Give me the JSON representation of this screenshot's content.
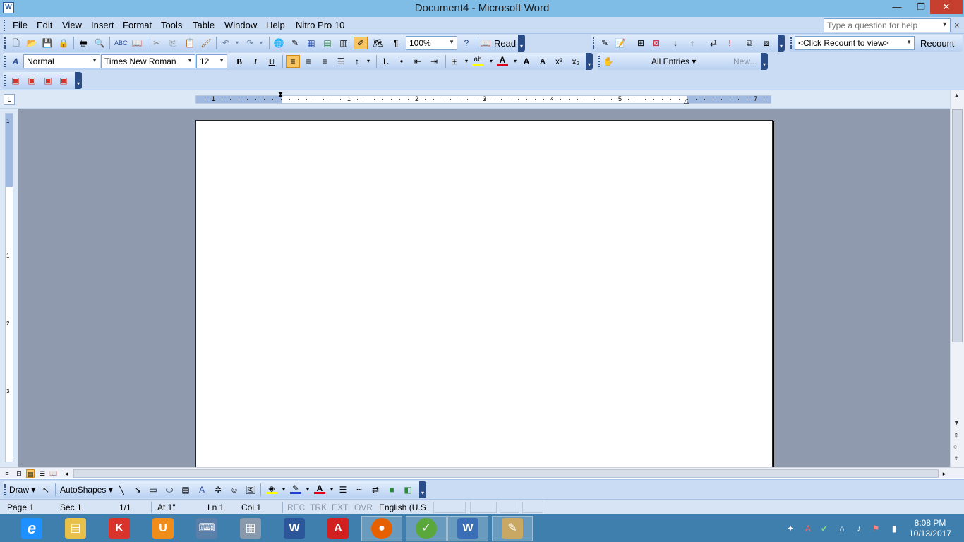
{
  "window": {
    "title": "Document4 - Microsoft Word",
    "min_glyph": "—",
    "max_glyph": "❐",
    "close_glyph": "✕"
  },
  "menu": {
    "items": [
      "File",
      "Edit",
      "View",
      "Insert",
      "Format",
      "Tools",
      "Table",
      "Window",
      "Help",
      "Nitro Pro 10"
    ],
    "help_placeholder": "Type a question for help",
    "doc_close_glyph": "×"
  },
  "standard_toolbar": {
    "zoom": "100%",
    "read_label": "Read",
    "icons": [
      "new-icon",
      "open-icon",
      "save-icon",
      "permission-icon",
      "print-icon",
      "print-preview-icon",
      "spelling-icon",
      "research-icon",
      "cut-icon",
      "copy-icon",
      "paste-icon",
      "format-painter-icon",
      "undo-icon",
      "redo-icon",
      "hyperlink-icon",
      "tables-borders-icon",
      "insert-table-icon",
      "insert-excel-icon",
      "columns-icon",
      "drawing-icon",
      "document-map-icon",
      "show-hide-icon",
      "help-icon"
    ]
  },
  "formatting_toolbar": {
    "style": "Normal",
    "font": "Times New Roman",
    "size": "12",
    "bold": "B",
    "italic": "I",
    "underline": "U",
    "highlight_color": "#ffff00",
    "font_color": "#e0001b"
  },
  "word_count_toolbar": {
    "recount_value": "<Click Recount to view>",
    "recount_label": "Recount"
  },
  "autotext_toolbar": {
    "all_entries": "All Entries ▾",
    "new_label": "New..."
  },
  "ruler": {
    "numbers": [
      "1",
      "1",
      "2",
      "3",
      "4",
      "5",
      "7"
    ],
    "tab_stop": "L"
  },
  "vertical_ruler": {
    "numbers": [
      "1",
      "1",
      "2",
      "3"
    ]
  },
  "draw_toolbar": {
    "draw_label": "Draw ▾",
    "autoshapes_label": "AutoShapes ▾"
  },
  "status": {
    "page": "Page 1",
    "sec": "Sec 1",
    "pages": "1/1",
    "at": "At 1\"",
    "ln": "Ln 1",
    "col": "Col 1",
    "rec": "REC",
    "trk": "TRK",
    "ext": "EXT",
    "ovr": "OVR",
    "language": "English (U.S"
  },
  "taskbar": {
    "apps": [
      {
        "name": "internet-explorer-icon",
        "glyph": "e",
        "color": "#1e90ff"
      },
      {
        "name": "file-explorer-icon",
        "glyph": "▤",
        "color": "#e8c14a"
      },
      {
        "name": "kingsoft-icon",
        "glyph": "K",
        "color": "#d9332b"
      },
      {
        "name": "uc-browser-icon",
        "glyph": "U",
        "color": "#f08c1a"
      },
      {
        "name": "keyboard-icon",
        "glyph": "⌨",
        "color": "#5b7fa8"
      },
      {
        "name": "calculator-icon",
        "glyph": "▦",
        "color": "#8a9aad"
      },
      {
        "name": "word-2013-icon",
        "glyph": "W",
        "color": "#2b579a"
      },
      {
        "name": "acrobat-icon",
        "glyph": "A",
        "color": "#d21f1f"
      },
      {
        "name": "firefox-icon",
        "glyph": "●",
        "color": "#e66000"
      },
      {
        "name": "greenshot-icon",
        "glyph": "✓",
        "color": "#5aa83c"
      },
      {
        "name": "word-2003-icon",
        "glyph": "W",
        "color": "#3a6fb8"
      },
      {
        "name": "paint-icon",
        "glyph": "✎",
        "color": "#c8a862"
      }
    ],
    "clock_time": "8:08 PM",
    "clock_date": "10/13/2017"
  },
  "colors": {
    "titlebar": "#7fbce6",
    "toolbar": "#c9dcf4",
    "doc_background": "#8f9aae",
    "taskbar": "#3f7fae",
    "close_button": "#c7402f"
  }
}
